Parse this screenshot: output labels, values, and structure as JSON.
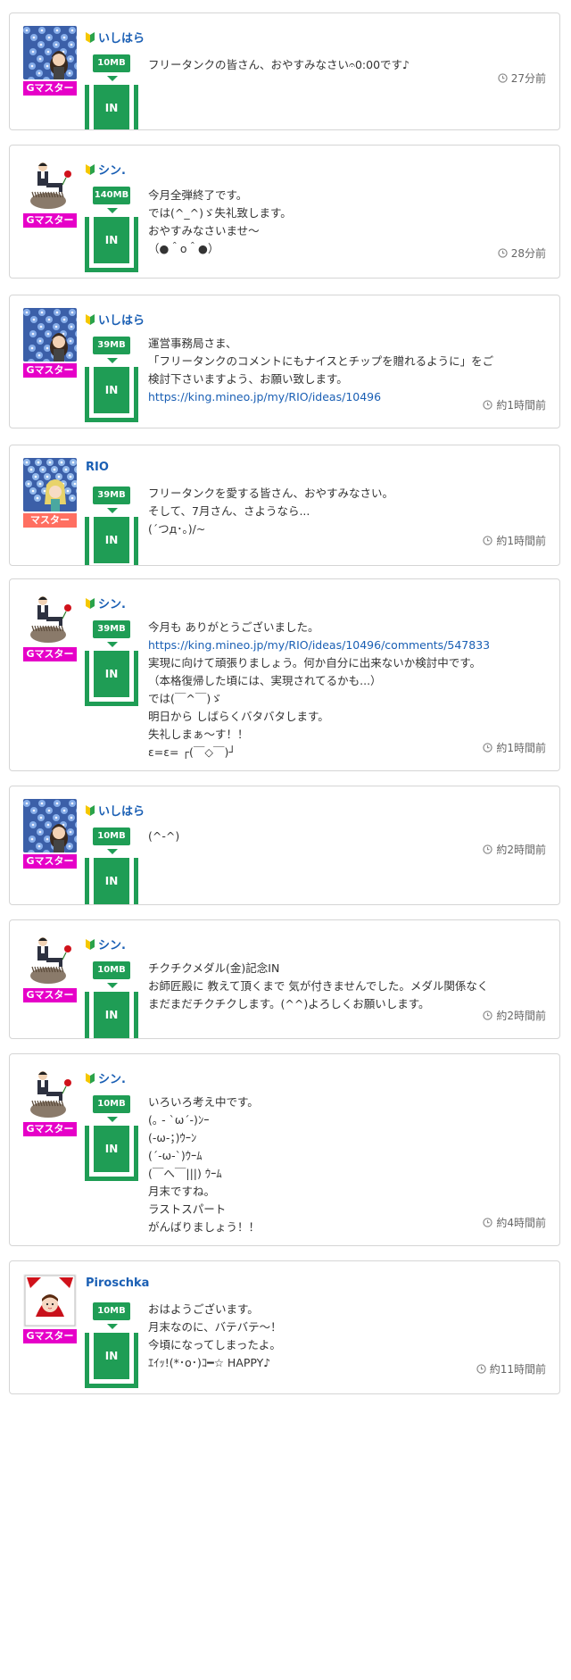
{
  "colors": {
    "accent_green": "#1f9d55",
    "link_blue": "#1a5fb4",
    "g_master_magenta": "#e600c8",
    "master_salmon": "#ff6f61",
    "border": "#d5d5d5"
  },
  "posts": [
    {
      "username": "いしはら",
      "beginner_mark": true,
      "avatar": "flowers-girl",
      "rank": "Gマスター",
      "rank_type": "gmaster",
      "data_amount": "10MB",
      "tank_label": "IN",
      "lines": [
        {
          "text": "フリータンクの皆さん、おやすみなさい𝄐0:00です♪",
          "link": false
        }
      ],
      "time": "27分前"
    },
    {
      "username": "シン.",
      "beginner_mark": true,
      "avatar": "man-on-hedgehog",
      "rank": "Gマスター",
      "rank_type": "gmaster",
      "data_amount": "140MB",
      "tank_label": "IN",
      "lines": [
        {
          "text": "今月全弾終了です。",
          "link": false
        },
        {
          "text": "では(^_^)ゞ失礼致します。",
          "link": false
        },
        {
          "text": "おやすみなさいませ〜",
          "link": false
        },
        {
          "text": "（●＾o＾●）",
          "link": false
        }
      ],
      "time": "28分前"
    },
    {
      "username": "いしはら",
      "beginner_mark": true,
      "avatar": "flowers-girl",
      "rank": "Gマスター",
      "rank_type": "gmaster",
      "data_amount": "39MB",
      "tank_label": "IN",
      "lines": [
        {
          "text": "運営事務局さま、",
          "link": false
        },
        {
          "text": "「フリータンクのコメントにもナイスとチップを贈れるように」をご",
          "link": false
        },
        {
          "text": "検討下さいますよう、お願い致します。",
          "link": false
        },
        {
          "text": "https://king.mineo.jp/my/RIO/ideas/10496",
          "link": true
        }
      ],
      "time": "約1時間前"
    },
    {
      "username": "RIO",
      "beginner_mark": false,
      "avatar": "flowers-blonde",
      "rank": "マスター",
      "rank_type": "master",
      "data_amount": "39MB",
      "tank_label": "IN",
      "lines": [
        {
          "text": "フリータンクを愛する皆さん、おやすみなさい。",
          "link": false
        },
        {
          "text": "そして、7月さん、さようなら...",
          "link": false
        },
        {
          "text": "(´つд･｡)/~",
          "link": false
        }
      ],
      "time": "約1時間前"
    },
    {
      "username": "シン.",
      "beginner_mark": true,
      "avatar": "man-on-hedgehog",
      "rank": "Gマスター",
      "rank_type": "gmaster",
      "data_amount": "39MB",
      "tank_label": "IN",
      "lines": [
        {
          "text": "今月も ありがとうございました。",
          "link": false
        },
        {
          "text": "https://king.mineo.jp/my/RIO/ideas/10496/comments/547833",
          "link": true
        },
        {
          "text": "実現に向けて頑張りましょう。何か自分に出来ないか検討中です。",
          "link": false
        },
        {
          "text": "（本格復帰した頃には、実現されてるかも...）",
          "link": false
        },
        {
          "text": "では(￣^￣)ゞ",
          "link": false
        },
        {
          "text": "明日から しばらくバタバタします。",
          "link": false
        },
        {
          "text": "失礼しまぁ〜す！！",
          "link": false
        },
        {
          "text": "ε=ε= ┌(￣◇￣)┘",
          "link": false
        }
      ],
      "time": "約1時間前"
    },
    {
      "username": "いしはら",
      "beginner_mark": true,
      "avatar": "flowers-girl",
      "rank": "Gマスター",
      "rank_type": "gmaster",
      "data_amount": "10MB",
      "tank_label": "IN",
      "lines": [
        {
          "text": "(^-^)",
          "link": false
        }
      ],
      "time": "約2時間前"
    },
    {
      "username": "シン.",
      "beginner_mark": true,
      "avatar": "man-on-hedgehog",
      "rank": "Gマスター",
      "rank_type": "gmaster",
      "data_amount": "10MB",
      "tank_label": "IN",
      "lines": [
        {
          "text": "チクチクメダル(金)記念IN",
          "link": false
        },
        {
          "text": "お師匠殿に 教えて頂くまで 気が付きませんでした。メダル関係なく",
          "link": false
        },
        {
          "text": "まだまだチクチクします。(^^)よろしくお願いします。",
          "link": false
        }
      ],
      "time": "約2時間前"
    },
    {
      "username": "シン.",
      "beginner_mark": true,
      "avatar": "man-on-hedgehog",
      "rank": "Gマスター",
      "rank_type": "gmaster",
      "data_amount": "10MB",
      "tank_label": "IN",
      "lines": [
        {
          "text": "いろいろ考え中です。",
          "link": false
        },
        {
          "text": "(｡ - `ω´-)ﾝｰ",
          "link": false
        },
        {
          "text": "(-ω-；)ｳｰﾝ",
          "link": false
        },
        {
          "text": "(´-ω-`)ｳｰﾑ",
          "link": false
        },
        {
          "text": "(￣へ￣|||) ｳｰﾑ",
          "link": false
        },
        {
          "text": "月末ですね。",
          "link": false
        },
        {
          "text": "ラストスパート",
          "link": false
        },
        {
          "text": "がんばりましょう！！",
          "link": false
        }
      ],
      "time": "約4時間前"
    },
    {
      "username": "Piroschka",
      "beginner_mark": false,
      "avatar": "red-hood-girl",
      "rank": "Gマスター",
      "rank_type": "gmaster",
      "data_amount": "10MB",
      "tank_label": "IN",
      "lines": [
        {
          "text": "おはようございます。",
          "link": false
        },
        {
          "text": "月末なのに、バテバテ〜！",
          "link": false
        },
        {
          "text": "今頃になってしまったよ。",
          "link": false
        },
        {
          "text": "ｴｲｯ!(*･o･)ｺ━☆ HAPPY♪",
          "link": false
        }
      ],
      "time": "約11時間前"
    }
  ]
}
